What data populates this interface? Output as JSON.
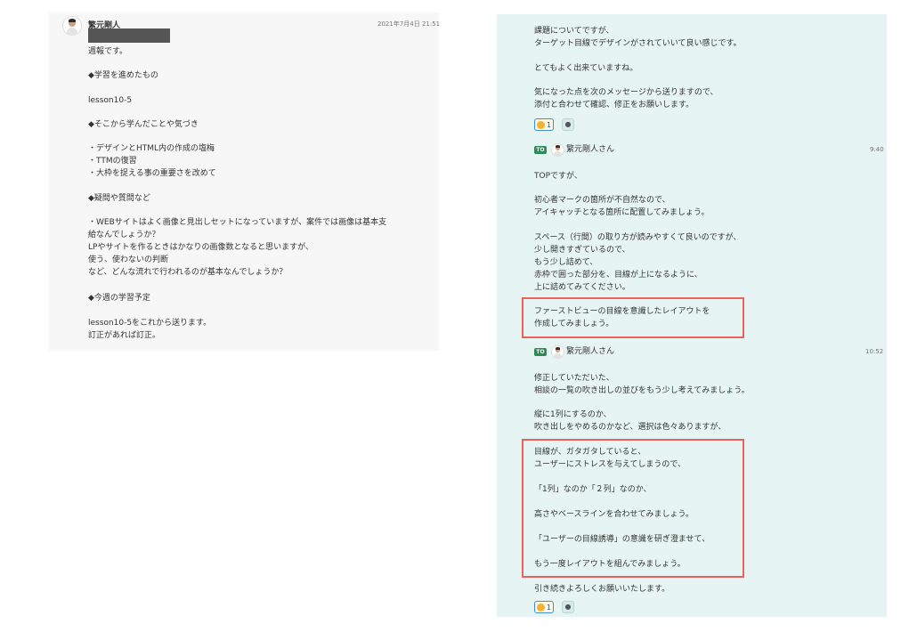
{
  "left_post": {
    "author": "繁元剛人",
    "timestamp": "2021年7月4日 21:51",
    "lines": [
      "週報です。",
      "",
      "◆学習を進めたもの",
      "",
      "lesson10-5",
      "",
      "◆そこから学んだことや気づき",
      "",
      "・デザインとHTML内の作成の塩梅",
      "・TTMの復習",
      "・大枠を捉える事の重要さを改めて",
      "",
      "◆疑問や質問など",
      "",
      "・WEBサイトはよく画像と見出しセットになっていますが、案件では画像は基本支",
      "給なんでしょうか？",
      "LPやサイトを作るときはかなりの画像数となると思いますが、",
      "使う、使わないの判断",
      "など、どんな流れで行われるのが基本なんでしょうか？",
      "",
      "◆今週の学習予定",
      "",
      "lesson10-5をこれから送ります。",
      "訂正があれば訂正。"
    ]
  },
  "right_chat": {
    "msg1_lines": [
      "課題についてですが、",
      "ターゲット目線でデザインがされていいて良い感じです。",
      "",
      "とてもよく出来ていますね。",
      "",
      "気になった点を次のメッセージから送りますので、",
      "添付と合わせて確認、修正をお願いします。"
    ],
    "reaction_count": "1",
    "to_label": "TO",
    "addressee": "繁元剛人さん",
    "msg2_time": "9:40",
    "msg2_lines": [
      "TOPですが、",
      "",
      "初心者マークの箇所が不自然なので、",
      "アイキャッチとなる箇所に配置してみましょう。",
      "",
      "スペース（行間）の取り方が読みやすくて良いのですが、",
      "少し開きすぎているので、",
      "もう少し詰めて、",
      "赤枠で囲った部分を、目線が上になるように、",
      "上に詰めてみてください。"
    ],
    "msg2_box_lines": [
      "ファーストビューの目線を意識したレイアウトを",
      "作成してみましょう。"
    ],
    "msg3_time": "10:52",
    "msg3_lines": [
      "修正していただいた、",
      "相談の一覧の吹き出しの並びをもう少し考えてみましょう。",
      "",
      "縦に1列にするのか、",
      "吹き出しをやめるのかなど、選択は色々ありますが、"
    ],
    "msg3_box_lines": [
      "目線が、ガタガタしていると、",
      "ユーザーにストレスを与えてしまうので、",
      "",
      "「1列」なのか「２列」なのか、",
      "",
      "高さやベースラインを合わせてみましょう。",
      "",
      "「ユーザーの目線誘導」の意識を研ぎ澄ませて、",
      "",
      "もう一度レイアウトを組んでみましょう。"
    ],
    "closing": "引き続きよろしくお願いいたします。"
  },
  "icons": [
    "avatar",
    "thumbs-up-emoji",
    "members-icon"
  ],
  "colors": {
    "right_bg": "#e6f5f3",
    "left_bg": "#f7f7f7",
    "highlight": "#e8635b",
    "to_badge": "#2e8b57"
  }
}
